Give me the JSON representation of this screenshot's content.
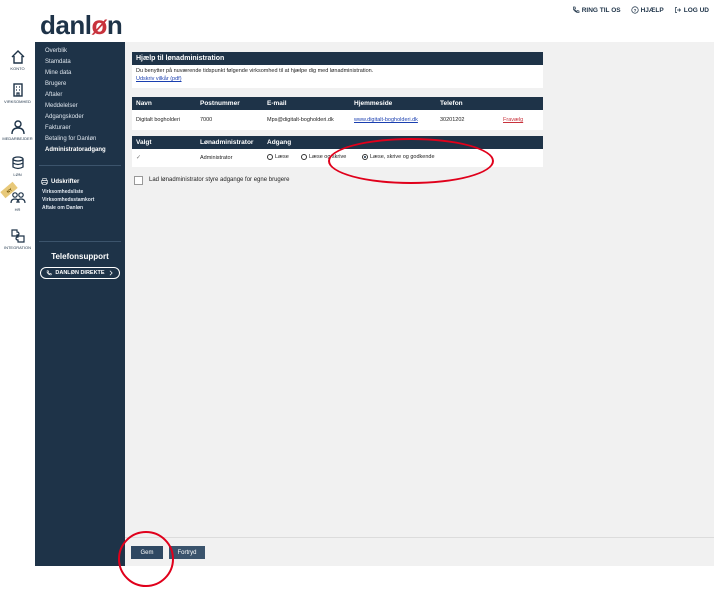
{
  "logo": {
    "text_main": "danl",
    "text_accent": "ø",
    "text_end": "n"
  },
  "top_nav": [
    {
      "label": "RING TIL OS",
      "icon": "phone-icon"
    },
    {
      "label": "HJÆLP",
      "icon": "question-icon"
    },
    {
      "label": "LOG UD",
      "icon": "logout-icon"
    }
  ],
  "rail": [
    {
      "label": "KONTO",
      "icon": "home-icon"
    },
    {
      "label": "VIRKSOMHED",
      "icon": "building-icon"
    },
    {
      "label": "MEDARBEJDER",
      "icon": "user-icon"
    },
    {
      "label": "LØN",
      "icon": "coins-icon"
    },
    {
      "label": "HR",
      "icon": "people-icon",
      "badge": "NY"
    },
    {
      "label": "INTEGRATION",
      "icon": "puzzle-icon"
    }
  ],
  "sidebar": {
    "links": [
      "Overblik",
      "Stamdata",
      "Mine data",
      "Brugere",
      "Aftaler",
      "Meddelelser",
      "Adgangskoder",
      "Fakturaer",
      "Betaling for Danløn",
      "Administratoradgang"
    ],
    "udskrifter_heading": "Udskrifter",
    "udskrifter": [
      "Virksomhedsliste",
      "Virksomhedsstamkort",
      "Aftale om Danløn"
    ],
    "support_title": "Telefonsupport",
    "support_button": "DANLØN DIREKTE"
  },
  "help_panel": {
    "title": "Hjælp til lønadministration",
    "text": "Du benytter på nuværende tidspunkt følgende virksomhed til at hjælpe dig med lønadministration.",
    "link": "Udskriv vilkår (pdf)"
  },
  "company_table": {
    "headers": [
      "Navn",
      "Postnummer",
      "E-mail",
      "Hjemmeside",
      "Telefon"
    ],
    "row": {
      "name": "Digitalt bogholderi",
      "postal": "7000",
      "email": "Mps@digitalt-bogholderi.dk",
      "website": "www.digitalt-bogholderi.dk",
      "phone": "30201202",
      "remove": "Fravælg"
    }
  },
  "access_table": {
    "headers": [
      "Valgt",
      "Lønadministrator",
      "Adgang"
    ],
    "row": {
      "check": "✓",
      "admin": "Administrator",
      "options": [
        {
          "label": "Læse",
          "selected": false
        },
        {
          "label": "Læse og skrive",
          "selected": false
        },
        {
          "label": "Læse, skrive og godkende",
          "selected": true
        }
      ]
    }
  },
  "checkbox": {
    "label": "Lad lønadministrator styre adgange for egne brugere",
    "checked": false
  },
  "footer": {
    "save": "Gem",
    "cancel": "Fortryd"
  },
  "colors": {
    "navy": "#1e3348",
    "accent_red": "#c8323c",
    "annotation_red": "#e0001b"
  }
}
